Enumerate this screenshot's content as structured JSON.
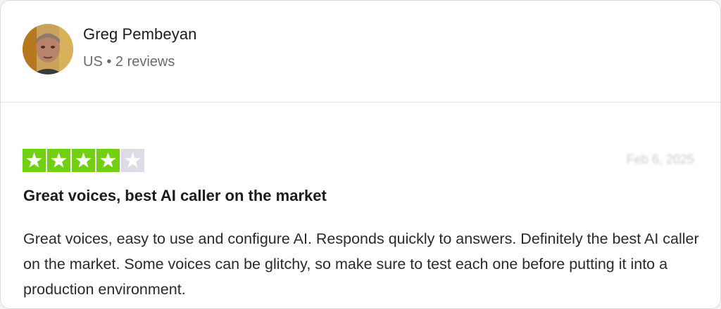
{
  "reviewer": {
    "name": "Greg Pembeyan",
    "country": "US",
    "separator": "•",
    "reviews_count": "2 reviews",
    "meta": "US • 2 reviews"
  },
  "rating": {
    "value": 4,
    "max": 5,
    "filled_color": "#73cf11",
    "empty_color": "#dcdce6",
    "icon": "star-icon"
  },
  "review": {
    "date": "Feb 6, 2025",
    "title": "Great voices, best AI caller on the market",
    "body": "Great voices, easy to use and configure AI. Responds quickly to answers. Definitely the best AI caller on the market. Some voices can be glitchy, so make sure to test each one before putting it into a production environment."
  }
}
